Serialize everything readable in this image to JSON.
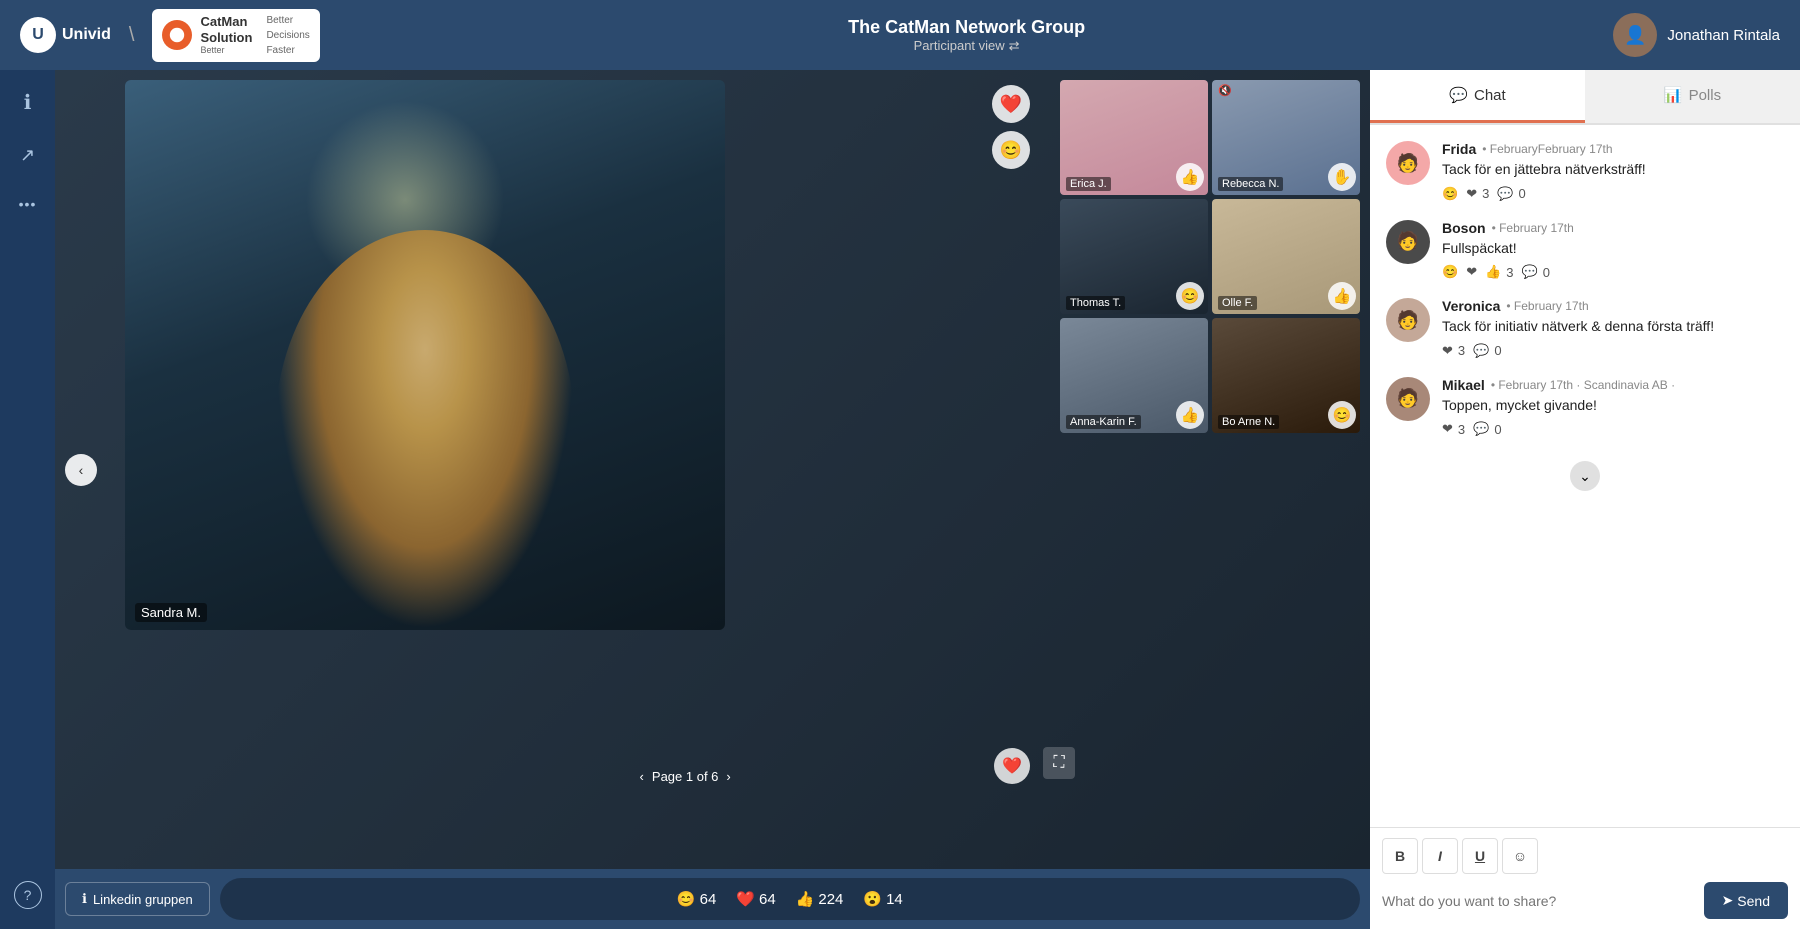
{
  "header": {
    "title": "The CatMan Network Group",
    "subtitle": "Participant view",
    "user_name": "Jonathan Rintala",
    "catman_tagline_1": "Better",
    "catman_tagline_2": "Decisions",
    "catman_tagline_3": "Faster"
  },
  "sidebar": {
    "info_icon": "ℹ",
    "share_icon": "↗",
    "more_icon": "•••",
    "help_icon": "?"
  },
  "video": {
    "main_speaker_name": "Sandra M.",
    "prev_button": "‹",
    "next_button": "›",
    "page_indicator": "Page 1 of 6",
    "thumbnails": [
      {
        "name": "Erica J.",
        "reaction": "👍"
      },
      {
        "name": "Rebecca N.",
        "reaction": "✋",
        "muted": true
      },
      {
        "name": "Thomas T.",
        "reaction": "😊"
      },
      {
        "name": "Olle F.",
        "reaction": "👍"
      },
      {
        "name": "Anna-Karin F.",
        "reaction": "👍"
      },
      {
        "name": "Bo Arne N.",
        "reaction": "😊"
      }
    ],
    "reaction_buttons": [
      "❤️",
      "😊"
    ],
    "side_reactions": [
      "❤️",
      "😊"
    ],
    "linkedin_label": "Linkedin gruppen",
    "reaction_counts": [
      {
        "emoji": "😊",
        "count": "64"
      },
      {
        "emoji": "❤️",
        "count": "64"
      },
      {
        "emoji": "👍",
        "count": "224"
      },
      {
        "emoji": "😮",
        "count": "14"
      }
    ]
  },
  "chat": {
    "tab_chat_label": "Chat",
    "tab_polls_label": "Polls",
    "messages": [
      {
        "id": "msg1",
        "author": "Frida",
        "time": "February 17th",
        "text": "Tack för en jättebra nätverksträff!",
        "reactions": [
          {
            "emoji": "😊",
            "count": ""
          },
          {
            "emoji": "❤",
            "count": "3"
          },
          {
            "emoji": "💬",
            "count": "0"
          }
        ],
        "avatar_emoji": "🧑",
        "avatar_class": "av-frida"
      },
      {
        "id": "msg2",
        "author": "Boson",
        "time": "February 17th",
        "text": "Fullspäckat!",
        "reactions": [
          {
            "emoji": "😊",
            "count": ""
          },
          {
            "emoji": "❤",
            "count": ""
          },
          {
            "emoji": "👍",
            "count": "3"
          },
          {
            "emoji": "💬",
            "count": "0"
          }
        ],
        "avatar_emoji": "🧑",
        "avatar_class": "av-boson"
      },
      {
        "id": "msg3",
        "author": "Veronica",
        "time": "February 17th",
        "text": "Tack för initiativ nätverk & denna första träff!",
        "reactions": [
          {
            "emoji": "❤",
            "count": "3"
          },
          {
            "emoji": "💬",
            "count": "0"
          }
        ],
        "avatar_emoji": "🧑",
        "avatar_class": "av-veronica"
      },
      {
        "id": "msg4",
        "author": "Mikael",
        "time": "February 17th",
        "org": "Scandinavia AB",
        "text": "Toppen, mycket givande!",
        "reactions": [
          {
            "emoji": "❤",
            "count": "3"
          },
          {
            "emoji": "💬",
            "count": "0"
          }
        ],
        "avatar_emoji": "🧑",
        "avatar_class": "av-mikael"
      }
    ],
    "input_placeholder": "What do you want to share?",
    "send_label": "Send",
    "toolbar": {
      "bold": "B",
      "italic": "I",
      "underline": "U",
      "emoji": "☺"
    }
  }
}
